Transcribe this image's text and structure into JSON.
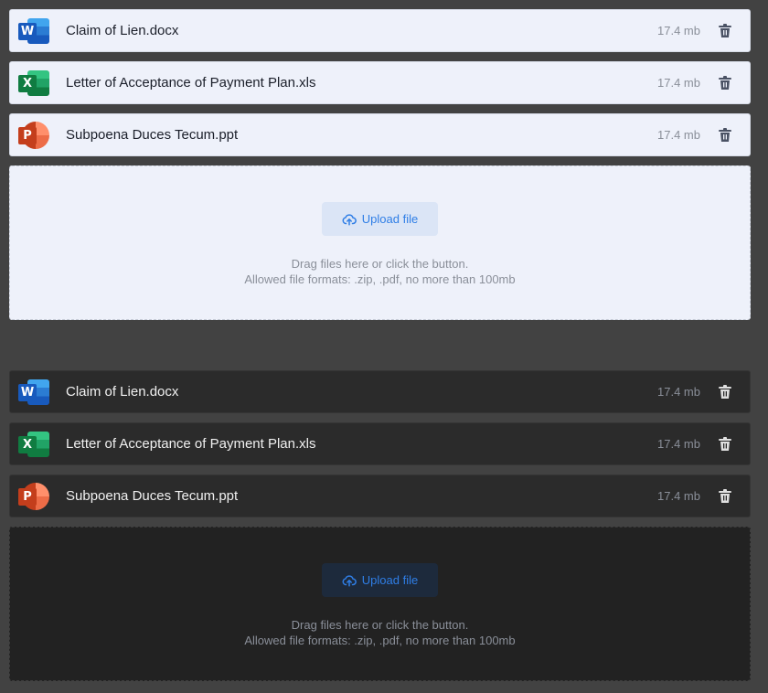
{
  "themes": [
    "light",
    "dark"
  ],
  "files": [
    {
      "name": "Claim of Lien.docx",
      "size": "17.4 mb",
      "app": "word",
      "badge": "W"
    },
    {
      "name": "Letter of Acceptance of Payment Plan.xls",
      "size": "17.4 mb",
      "app": "excel",
      "badge": "X"
    },
    {
      "name": "Subpoena Duces Tecum.ppt",
      "size": "17.4 mb",
      "app": "ppt",
      "badge": "P"
    }
  ],
  "upload": {
    "button_label": "Upload file",
    "hint_line1": "Drag files here or click the button.",
    "hint_line2": "Allowed file formats: .zip, .pdf, no more than 100mb"
  },
  "icons": {
    "delete": "trash-icon",
    "upload": "cloud-upload-icon"
  },
  "colors": {
    "page_bg": "#424242",
    "light_card": "#eef1fa",
    "dark_card": "#2b2b2b",
    "accent": "#2f7ee6",
    "muted": "#8a8f99"
  }
}
